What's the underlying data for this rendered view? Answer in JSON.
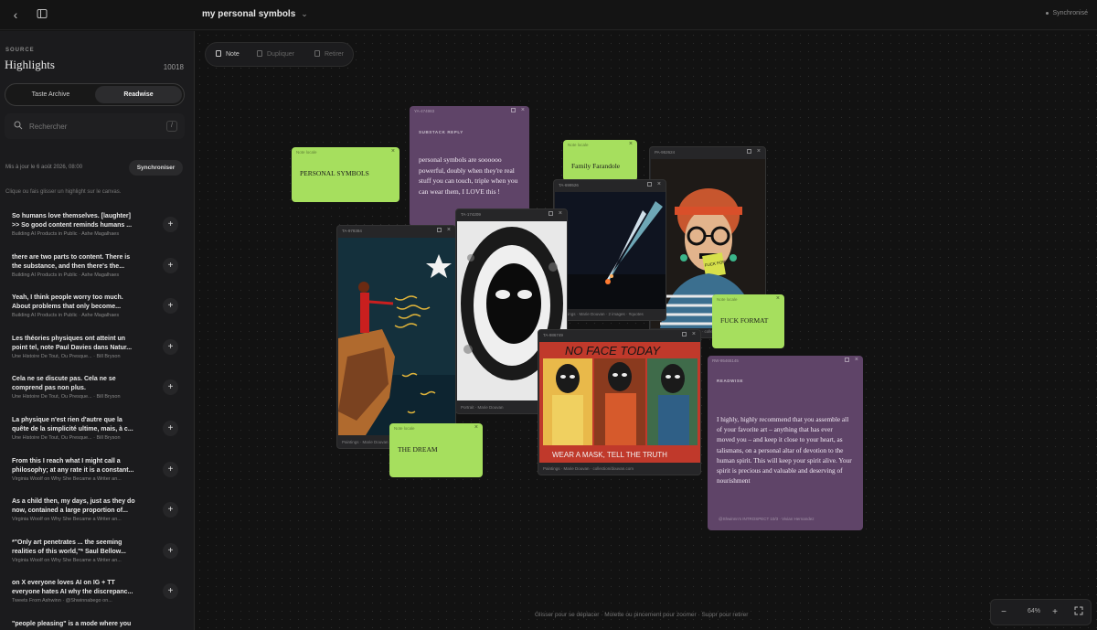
{
  "topbar": {
    "title": "my personal symbols",
    "sync_status": "Synchronisé"
  },
  "sidebar": {
    "source_label": "SOURCE",
    "source_title": "Highlights",
    "count": "10018",
    "tabs": [
      "Taste Archive",
      "Readwise"
    ],
    "active_tab": "Readwise",
    "search_placeholder": "Rechercher",
    "search_shortcut": "/",
    "updated": "Mis à jour le 6 août 2026, 08:00",
    "sync_button": "Synchroniser",
    "hint": "Clique ou fais glisser un highlight sur le canvas.",
    "highlights": [
      {
        "text": "So humans love themselves. [laughter]\n>> So good content reminds humans ...",
        "author": "Building AI Products in Public · Ashe Magalhaes",
        "plus": "+"
      },
      {
        "text": "there are two parts to content. There is\nthe substance, and then there's the...",
        "author": "Building AI Products in Public · Ashe Magalhaes",
        "plus": "+"
      },
      {
        "text": "Yeah, I think people worry too much.\nAbout problems that only become...",
        "author": "Building AI Products in Public · Ashe Magalhaes",
        "plus": "+"
      },
      {
        "text": "Les théories physiques ont atteint un\npoint tel, note Paul Davies dans Natur...",
        "author": "Une Histoire De Tout, Ou Presque... · Bill Bryson",
        "plus": "+"
      },
      {
        "text": "Cela ne se discute pas. Cela ne se\ncomprend pas non plus.",
        "author": "Une Histoire De Tout, Ou Presque... · Bill Bryson",
        "plus": "+"
      },
      {
        "text": "La physique n'est rien d'autre que la\nquête de la simplicité ultime, mais, à c...",
        "author": "Une Histoire De Tout, Ou Presque... · Bill Bryson",
        "plus": "+"
      },
      {
        "text": "From this I reach what I might call a\nphilosophy; at any rate it is a constant...",
        "author": "Virginia Woolf on Why She Became a Writer an...",
        "plus": "+"
      },
      {
        "text": "As a child then, my days, just as they do\nnow, contained a large proportion of...",
        "author": "Virginia Woolf on Why She Became a Writer an...",
        "plus": "+"
      },
      {
        "text": "*\"Only art penetrates ... the seeming\nrealities of this world,\"* Saul Bellow...",
        "author": "Virginia Woolf on Why She Became a Writer an...",
        "plus": "+"
      },
      {
        "text": "on X everyone loves AI on IG + TT\neveryone hates AI why the discrepanc...",
        "author": "Tweets From Ashwinn · @Shwinnabego on...",
        "plus": "+"
      },
      {
        "text": "\"people pleasing\" is a mode where you",
        "author": "",
        "plus": ""
      }
    ]
  },
  "toolbar": {
    "note": "Note",
    "duplicate": "Dupliquer",
    "remove": "Retirer"
  },
  "canvas": {
    "footer_hint": "Glisser pour se déplacer · Molette ou pincement pour zoomer · Suppr pour retirer",
    "zoom": "64%",
    "zoom_minus": "−",
    "zoom_plus": "+"
  },
  "cards": {
    "note_personal": {
      "id": "Note locale",
      "text": "PERSONAL SYMBOLS"
    },
    "quote_substack": {
      "id": "YA-474983",
      "label": "SUBSTACK REPLY",
      "text": "personal symbols are soooooo powerful, doubly when they're real stuff you can touch, triple when you can wear them, I LOVE this !"
    },
    "note_family": {
      "id": "Note locale",
      "text": "Family Farandole"
    },
    "img_woman_glasses": {
      "id": "PA-952624",
      "caption": "Paintings · Marie Douvan · collection"
    },
    "img_beam": {
      "id": "TA-699526",
      "caption": "Paintings · Marie Douvan · 2 images · #quotes"
    },
    "note_fuck": {
      "id": "Note locale",
      "text": "FUCK FORMAT"
    },
    "img_cliff": {
      "id": "TA-978384",
      "caption": "Paintings · Marie Douvan"
    },
    "img_mask": {
      "id": "TA-174209",
      "caption": "Portrait · Marie Douvan"
    },
    "note_dream": {
      "id": "Note locale",
      "text": "THE DREAM"
    },
    "img_noface": {
      "id": "TA-986749",
      "caption": "Paintings · Marie Douvan · collection/douvan.com"
    },
    "quote_readwise": {
      "id": "RW-95465145",
      "label": "READWISE",
      "text": "I highly, highly recommend that you assemble all of your favorite art – anything that has ever moved you – and keep it close to your heart, as talismans, on a personal altar of devotion to the human spirit. This will keep your spirit alive. Your spirit is precious and valuable and deserving of nourishment",
      "source": "@Shwinnn's INTROSPECT 10/3 · Vivian Hernandez"
    }
  },
  "painting_text": {
    "noface_top": "NO FACE TODAY",
    "noface_bottom": "WEAR A MASK, TELL THE TRUTH",
    "glasses_sign": "FUCK FORMAT"
  },
  "colors": {
    "note_green": "#a6df5e",
    "quote_purple": "#5f4468",
    "canvas_bg": "#121212",
    "sidebar_bg": "#1b1b1d"
  }
}
